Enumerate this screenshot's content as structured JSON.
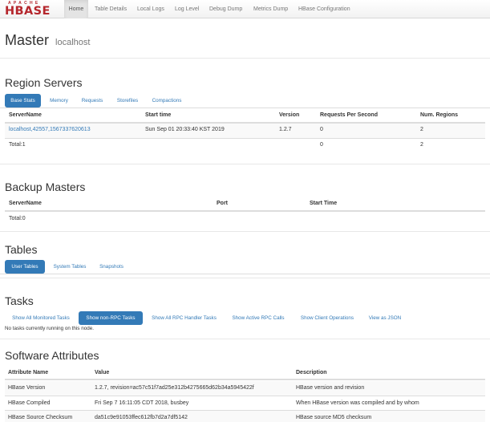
{
  "logo": {
    "apache": "APACHE",
    "hbase": "HBASE"
  },
  "nav": [
    "Home",
    "Table Details",
    "Local Logs",
    "Log Level",
    "Debug Dump",
    "Metrics Dump",
    "HBase Configuration"
  ],
  "master": {
    "title": "Master",
    "host": "localhost"
  },
  "region_servers": {
    "title": "Region Servers",
    "tabs": [
      "Base Stats",
      "Memory",
      "Requests",
      "Storefiles",
      "Compactions"
    ],
    "headers": [
      "ServerName",
      "Start time",
      "Version",
      "Requests Per Second",
      "Num. Regions"
    ],
    "row": [
      "localhost,42557,1567337620613",
      "Sun Sep 01 20:33:40 KST 2019",
      "1.2.7",
      "0",
      "2"
    ],
    "total": [
      "Total:1",
      "0",
      "2"
    ]
  },
  "backup_masters": {
    "title": "Backup Masters",
    "headers": [
      "ServerName",
      "Port",
      "Start Time"
    ],
    "total": "Total:0"
  },
  "tables": {
    "title": "Tables",
    "tabs": [
      "User Tables",
      "System Tables",
      "Snapshots"
    ]
  },
  "tasks": {
    "title": "Tasks",
    "tabs": [
      "Show All Monitored Tasks",
      "Show non-RPC Tasks",
      "Show All RPC Handler Tasks",
      "Show Active RPC Calls",
      "Show Client Operations",
      "View as JSON"
    ],
    "note": "No tasks currently running on this node."
  },
  "software": {
    "title": "Software Attributes",
    "headers": [
      "Attribute Name",
      "Value",
      "Description"
    ],
    "rows": [
      [
        "HBase Version",
        "1.2.7, revision=ac57c51f7ad25e312b4275665d62b34a5945422f",
        "HBase version and revision"
      ],
      [
        "HBase Compiled",
        "Fri Sep 7 16:11:05 CDT 2018, busbey",
        "When HBase version was compiled and by whom"
      ],
      [
        "HBase Source Checksum",
        "da51c9e91053ffec612fb7d2a7df5142",
        "HBase source MD5 checksum"
      ]
    ]
  },
  "colors": {
    "brand": "#b5272d",
    "link": "#337ab7",
    "active_tab": "#337ab7"
  }
}
